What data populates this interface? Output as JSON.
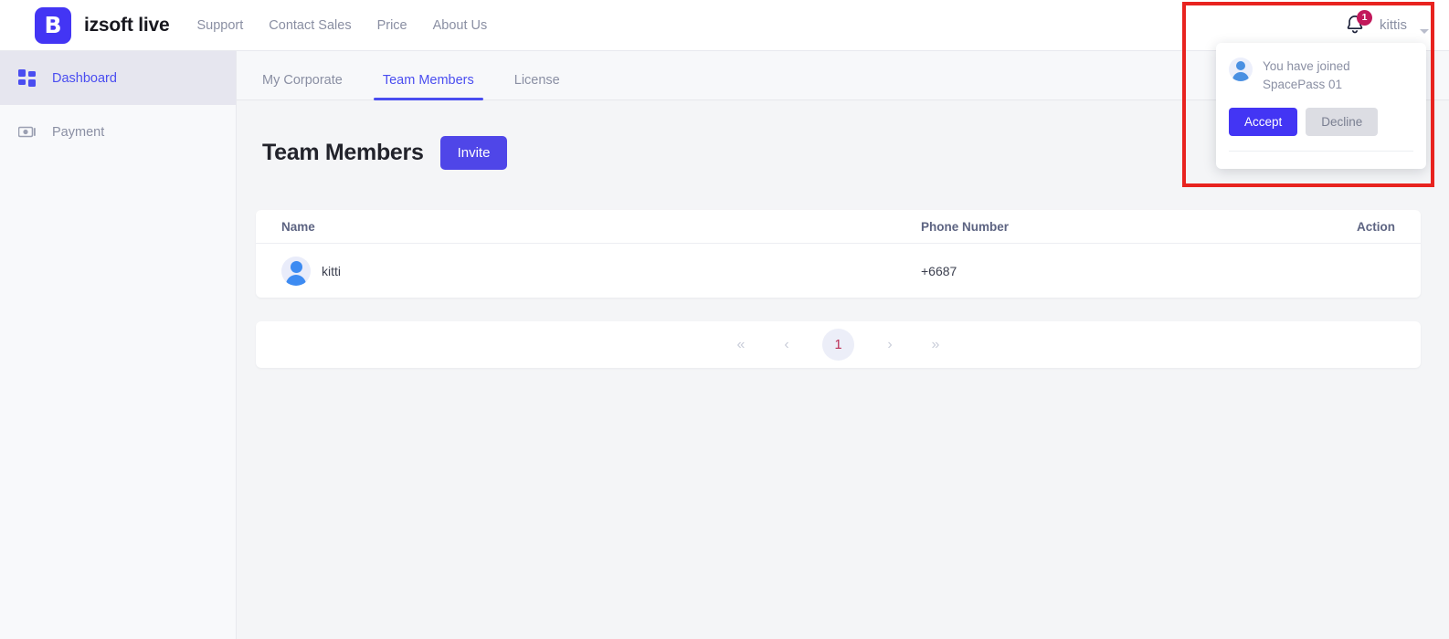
{
  "brand": {
    "logo_letter": "B",
    "name": "izsoft live"
  },
  "topnav": {
    "links": [
      {
        "label": "Support"
      },
      {
        "label": "Contact Sales"
      },
      {
        "label": "Price"
      },
      {
        "label": "About Us"
      }
    ],
    "bell_icon": "bell-icon",
    "notification_count": "1",
    "user_name": "kittis",
    "caret_icon": "chevron-down-icon"
  },
  "notification_panel": {
    "avatar_icon": "user-avatar-icon",
    "message": "You have joined SpacePass 01",
    "accept_label": "Accept",
    "decline_label": "Decline"
  },
  "sidebar": {
    "items": [
      {
        "label": "Dashboard",
        "icon": "dashboard-grid-icon",
        "active": true
      },
      {
        "label": "Payment",
        "icon": "payment-card-icon",
        "active": false
      }
    ]
  },
  "tabs": [
    {
      "label": "My Corporate",
      "active": false
    },
    {
      "label": "Team Members",
      "active": true
    },
    {
      "label": "License",
      "active": false
    }
  ],
  "page": {
    "title": "Team Members",
    "invite_label": "Invite"
  },
  "table": {
    "columns": [
      "Name",
      "Phone Number",
      "Action"
    ],
    "rows": [
      {
        "name": "kitti",
        "phone": "+6687",
        "action": "",
        "avatar_icon": "user-avatar-icon"
      }
    ]
  },
  "pagination": {
    "first_label": "«",
    "prev_label": "‹",
    "current_page": "1",
    "next_label": "›",
    "last_label": "»"
  },
  "colors": {
    "brand_purple": "#4335f4",
    "accent_indigo": "#4a4df0",
    "badge_crimson": "#c2185b",
    "annotation_red": "#e8231f",
    "page_bg": "#f4f5f7"
  }
}
